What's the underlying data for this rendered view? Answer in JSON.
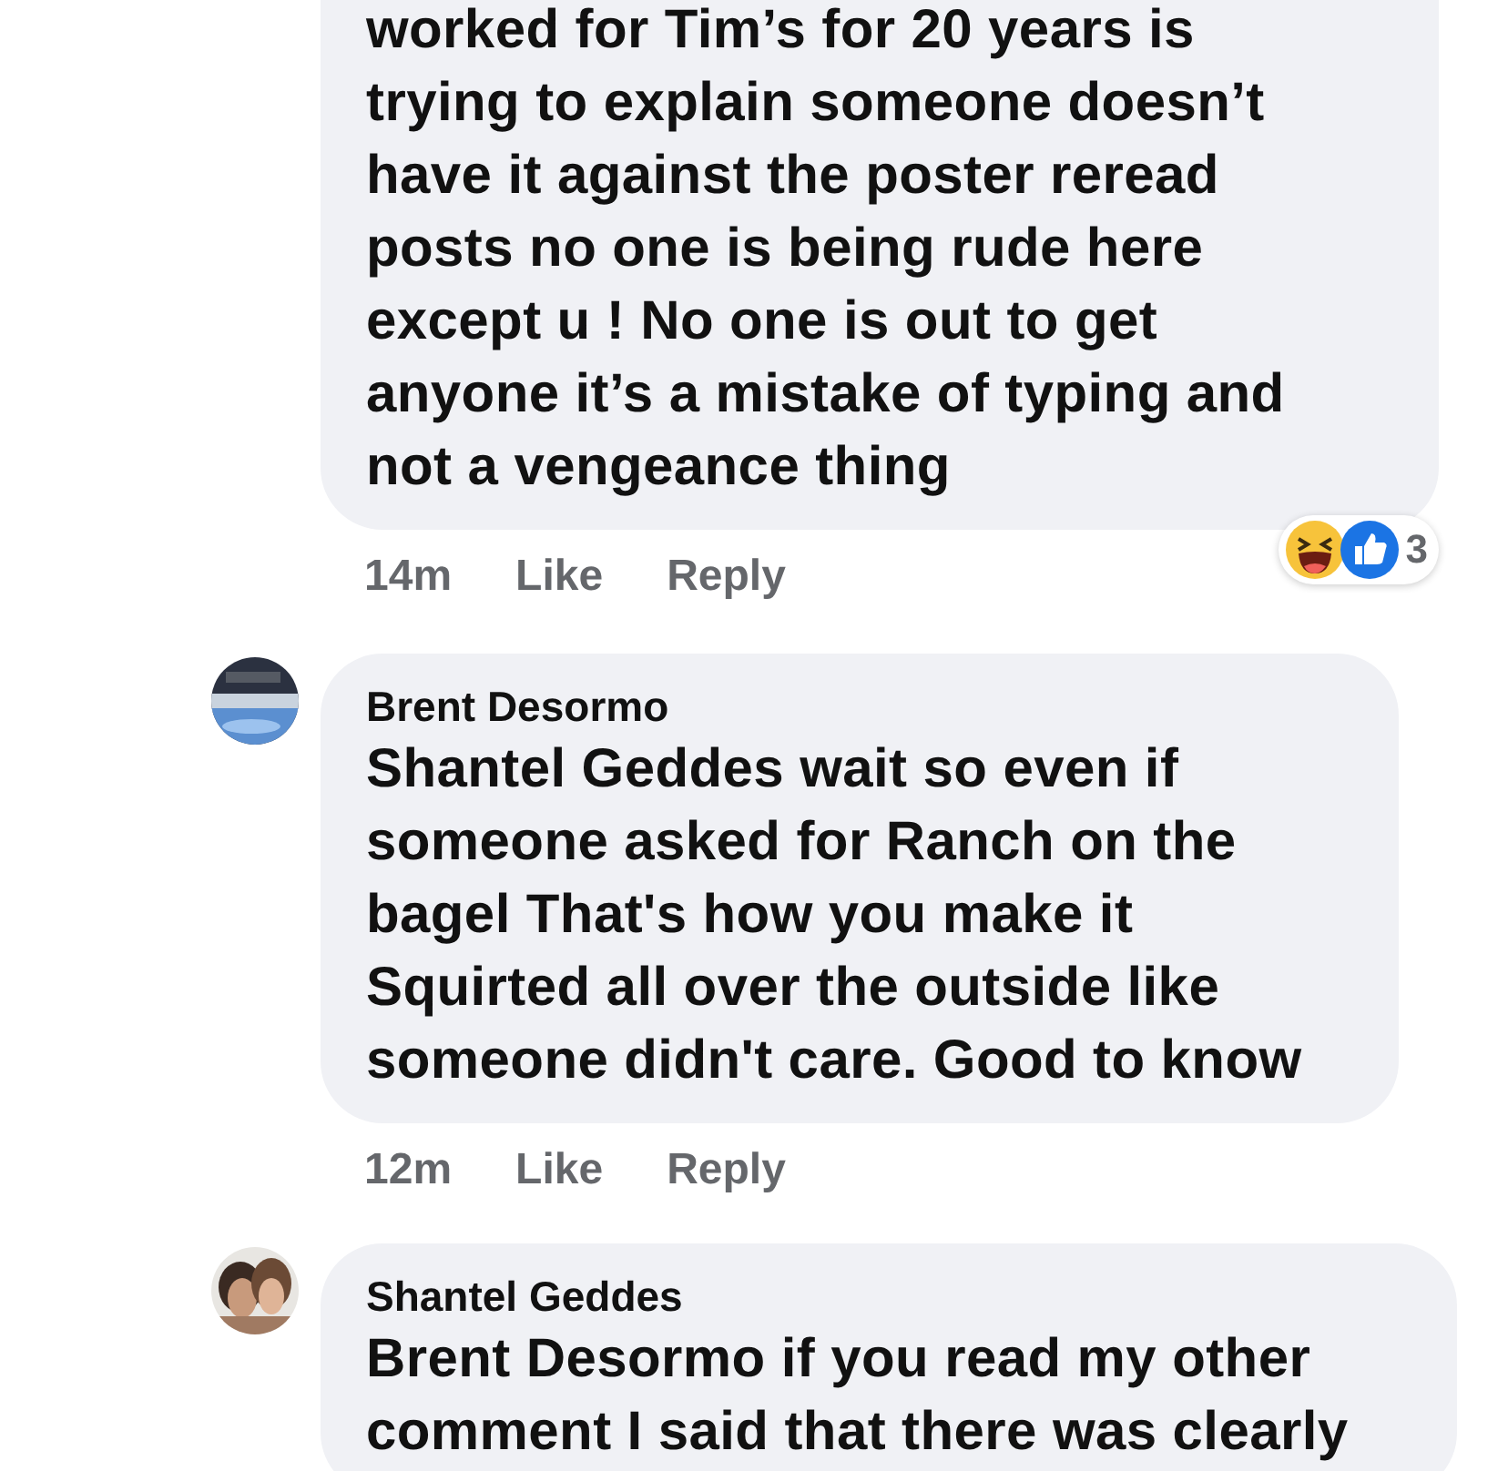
{
  "comments": [
    {
      "text": "worked for Tim’s for 20 years is trying to explain someone doesn’t have it against the poster reread posts no one is being rude here except u !  No one is out to get anyone it’s a mistake of typing and not a vengeance thing",
      "time": "14m",
      "actions": [
        "Like",
        "Reply"
      ],
      "reactions": {
        "count": "3"
      }
    },
    {
      "author": "Brent Desormo",
      "avatar": {
        "kind": "picture"
      },
      "text": "**Shantel Geddes** wait so even if someone asked for Ranch on the bagel That's how you make it Squirted all over the outside like someone didn't care. Good to know",
      "time": "12m",
      "actions": [
        "Like",
        "Reply"
      ]
    },
    {
      "author": "Shantel Geddes",
      "avatar": {
        "kind": "picture"
      },
      "text": "**Brent Desormo** if you read my other comment I said that there was clearly"
    }
  ]
}
